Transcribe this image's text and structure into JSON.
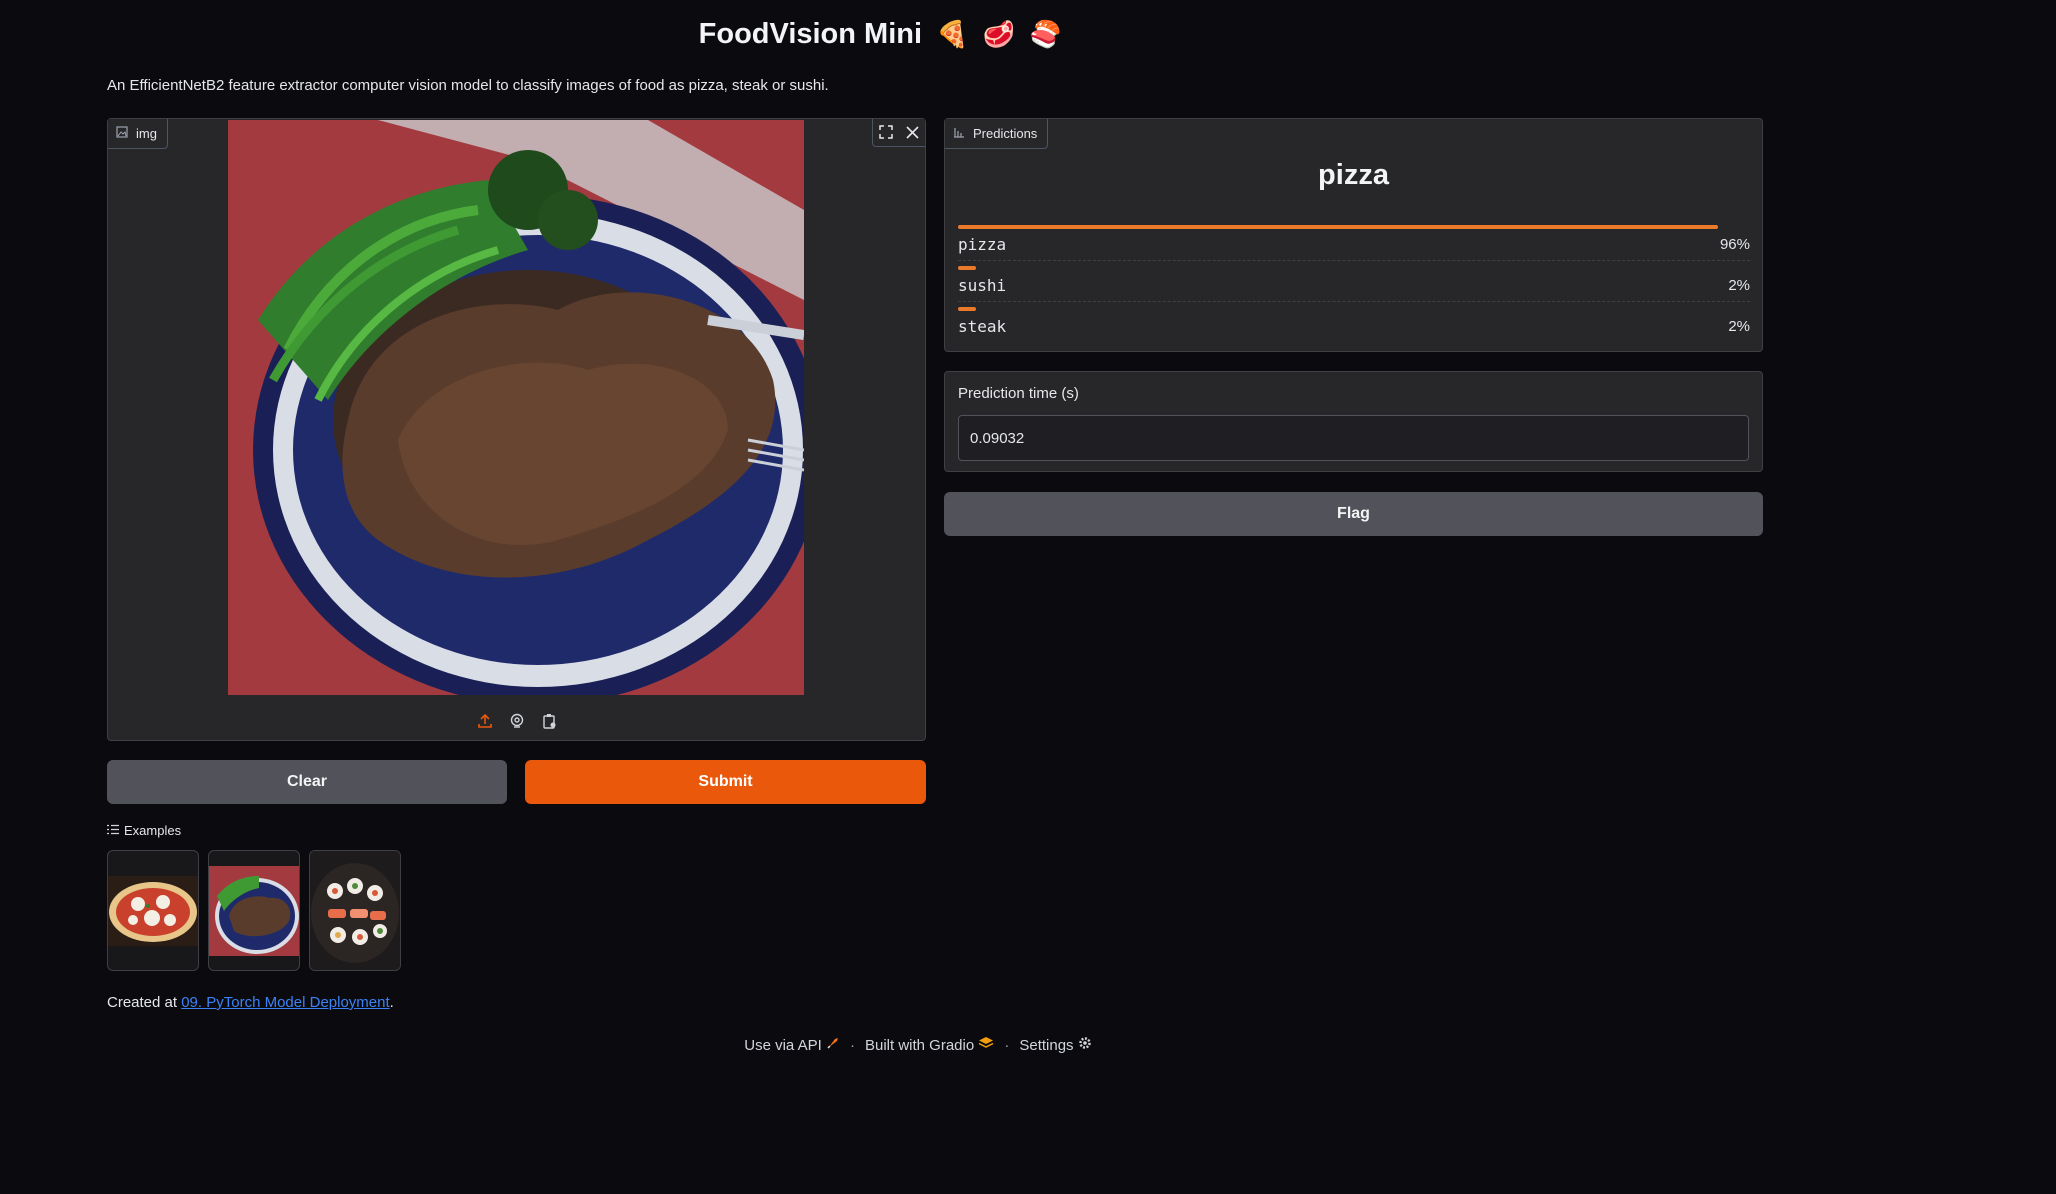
{
  "header": {
    "title": "FoodVision Mini",
    "emojis": [
      "🍕",
      "🥩",
      "🍣"
    ],
    "description": "An EfficientNetB2 feature extractor computer vision model to classify images of food as pizza, steak or sushi."
  },
  "image_input": {
    "label": "img",
    "icons": [
      "image-icon",
      "fullscreen-icon",
      "close-icon",
      "upload-icon",
      "webcam-icon",
      "clipboard-icon"
    ]
  },
  "buttons": {
    "clear": "Clear",
    "submit": "Submit",
    "flag": "Flag"
  },
  "examples": {
    "label": "Examples",
    "items": [
      "pizza",
      "steak",
      "sushi"
    ]
  },
  "predictions": {
    "label": "Predictions",
    "top_label": "pizza",
    "items": [
      {
        "label": "pizza",
        "value": 0.96,
        "pct": "96%"
      },
      {
        "label": "sushi",
        "value": 0.02,
        "pct": "2%"
      },
      {
        "label": "steak",
        "value": 0.02,
        "pct": "2%"
      }
    ]
  },
  "prediction_time": {
    "label": "Prediction time (s)",
    "value": "0.09032"
  },
  "created": {
    "prefix": "Created at ",
    "link": "09. PyTorch Model Deployment",
    "suffix": "."
  },
  "footer": {
    "api": "Use via API",
    "built": "Built with Gradio",
    "settings": "Settings"
  },
  "colors": {
    "accent": "#ea580c",
    "bar": "#ea7a2a",
    "panel": "#27272a",
    "background": "#0b0b0f",
    "link": "#3b82f6"
  }
}
